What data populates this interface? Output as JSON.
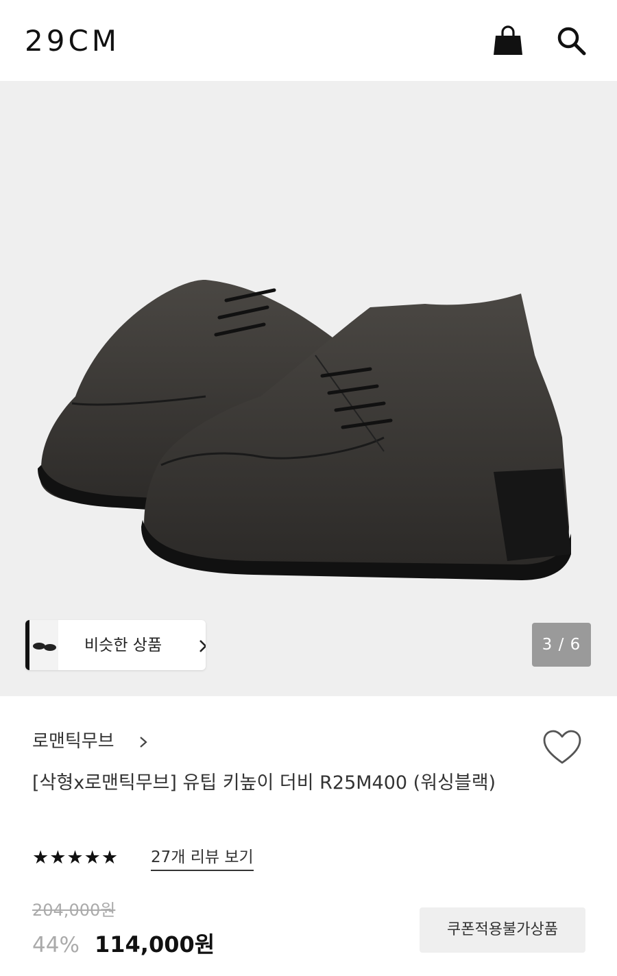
{
  "header": {
    "logo": "29CM",
    "bag_icon": "shopping-bag-icon",
    "search_icon": "search-icon"
  },
  "gallery": {
    "similar_label": "비슷한 상품",
    "counter": "3 / 6"
  },
  "product": {
    "brand": "로맨틱무브",
    "title": "[삭형x로맨틱무브] 유팁 키높이 더비 R25M400 (워싱블랙)",
    "rating_stars": "★★★★★",
    "rating_value": 5,
    "review_link": "27개 리뷰 보기",
    "original_price": "204,000원",
    "discount": "44%",
    "price": "114,000원",
    "coupon_badge": "쿠폰적용불가상품"
  },
  "colors": {
    "gallery_bg": "#efefef",
    "counter_bg": "#9a9a9a",
    "coupon_bg": "#efefef",
    "muted_text": "#aaaaaa"
  }
}
